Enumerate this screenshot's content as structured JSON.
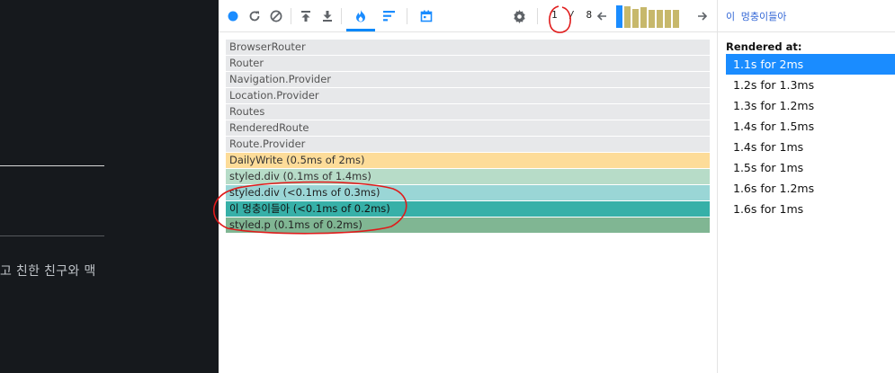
{
  "page": {
    "body_text": "고 친한 친구와 맥"
  },
  "toolbar": {
    "commit_index": "1",
    "commit_separator": "/",
    "commit_total": "8",
    "icons": [
      "record-icon",
      "reload-icon",
      "clear-icon",
      "load-profile-icon",
      "save-profile-icon",
      "flamegraph-icon",
      "ranked-chart-icon",
      "timeline-icon",
      "settings-icon",
      "prev-commit-icon",
      "next-commit-icon"
    ],
    "accent_color": "#0088fa"
  },
  "commits": [
    {
      "level": 1.0,
      "selected": true
    },
    {
      "level": 0.95,
      "selected": false
    },
    {
      "level": 0.85,
      "selected": false
    },
    {
      "level": 0.9,
      "selected": false
    },
    {
      "level": 0.8,
      "selected": false
    },
    {
      "level": 0.8,
      "selected": false
    },
    {
      "level": 0.8,
      "selected": false
    },
    {
      "level": 0.8,
      "selected": false
    }
  ],
  "flamegraph": {
    "rows": [
      {
        "label": "BrowserRouter",
        "color": "#e7e8ea",
        "text_color": "#555555"
      },
      {
        "label": "Router",
        "color": "#e7e8ea",
        "text_color": "#555555"
      },
      {
        "label": "Navigation.Provider",
        "color": "#e7e8ea",
        "text_color": "#555555"
      },
      {
        "label": "Location.Provider",
        "color": "#e7e8ea",
        "text_color": "#555555"
      },
      {
        "label": "Routes",
        "color": "#e7e8ea",
        "text_color": "#555555"
      },
      {
        "label": "RenderedRoute",
        "color": "#e7e8ea",
        "text_color": "#555555"
      },
      {
        "label": "Route.Provider",
        "color": "#e7e8ea",
        "text_color": "#555555"
      },
      {
        "label": "DailyWrite (0.5ms of 2ms)",
        "color": "#fddc99",
        "text_color": "#333333"
      },
      {
        "label": "styled.div (0.1ms of 1.4ms)",
        "color": "#b7dcc8",
        "text_color": "#333333"
      },
      {
        "label": "styled.div (<0.1ms of 0.3ms)",
        "color": "#9ad6d6",
        "text_color": "#222222"
      },
      {
        "label": "이 멍충이들아 (<0.1ms of 0.2ms)",
        "color": "#37b0a8",
        "text_color": "#111111"
      },
      {
        "label": "styled.p (0.1ms of 0.2ms)",
        "color": "#80b693",
        "text_color": "#222222"
      }
    ]
  },
  "side_panel": {
    "title": "이 멍충이들아",
    "rendered_at_label": "Rendered at:",
    "renders": [
      {
        "label": "1.1s for 2ms",
        "selected": true
      },
      {
        "label": "1.2s for 1.3ms",
        "selected": false
      },
      {
        "label": "1.3s for 1.2ms",
        "selected": false
      },
      {
        "label": "1.4s for 1.5ms",
        "selected": false
      },
      {
        "label": "1.4s for 1ms",
        "selected": false
      },
      {
        "label": "1.5s for 1ms",
        "selected": false
      },
      {
        "label": "1.6s for 1.2ms",
        "selected": false
      },
      {
        "label": "1.6s for 1ms",
        "selected": false
      }
    ]
  }
}
